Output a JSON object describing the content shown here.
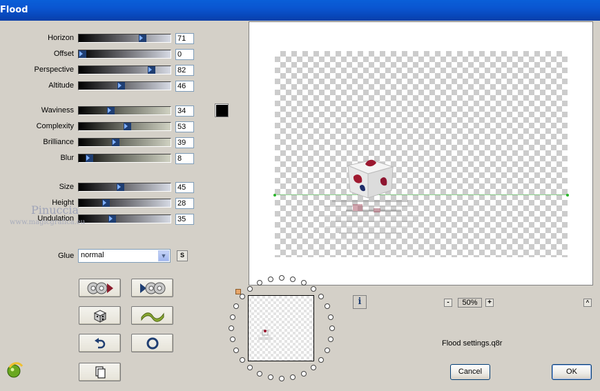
{
  "window": {
    "title": "Flood"
  },
  "sliders_group1": [
    {
      "label": "Horizon",
      "value": "71",
      "pct": 71
    },
    {
      "label": "Offset",
      "value": "0",
      "pct": 0
    },
    {
      "label": "Perspective",
      "value": "82",
      "pct": 82
    },
    {
      "label": "Altitude",
      "value": "46",
      "pct": 46
    }
  ],
  "sliders_group2": [
    {
      "label": "Waviness",
      "value": "34",
      "pct": 34
    },
    {
      "label": "Complexity",
      "value": "53",
      "pct": 53
    },
    {
      "label": "Brilliance",
      "value": "39",
      "pct": 39
    },
    {
      "label": "Blur",
      "value": "8",
      "pct": 8
    }
  ],
  "sliders_group3": [
    {
      "label": "Size",
      "value": "45",
      "pct": 45
    },
    {
      "label": "Height",
      "value": "28",
      "pct": 28
    },
    {
      "label": "Undulation",
      "value": "35",
      "pct": 35
    }
  ],
  "color_swatch": "#000000",
  "watermark": {
    "name": "Pinuccia",
    "site": "www.magicgrafica.eu"
  },
  "glue": {
    "label": "Glue",
    "value": "normal",
    "s_button": "S"
  },
  "icon_buttons": [
    {
      "name": "load-preset-icon"
    },
    {
      "name": "save-preset-icon"
    },
    {
      "name": "random-dice-icon"
    },
    {
      "name": "wave-icon"
    },
    {
      "name": "undo-icon"
    },
    {
      "name": "reset-icon"
    },
    {
      "name": "copy-icon"
    }
  ],
  "info_button": "i",
  "zoom": {
    "minus": "-",
    "value": "50%",
    "plus": "+"
  },
  "collapse_button": "^",
  "settings_file": "Flood settings.q8r",
  "buttons": {
    "cancel": "Cancel",
    "ok": "OK"
  }
}
